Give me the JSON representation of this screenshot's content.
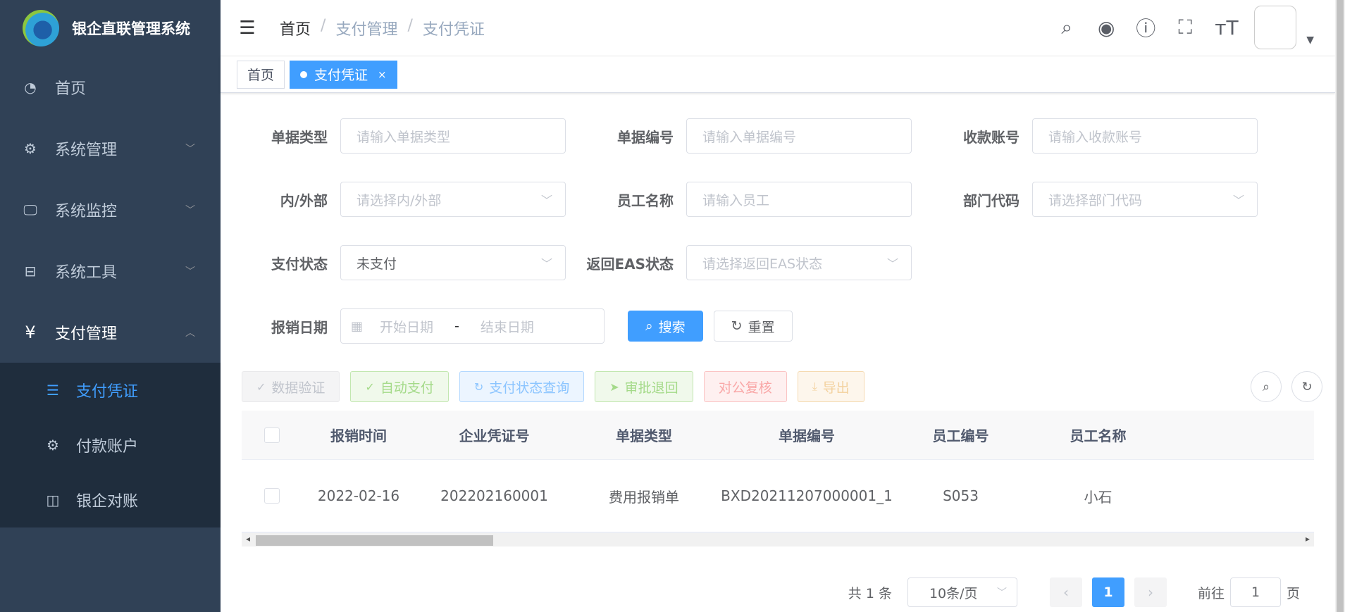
{
  "app": {
    "title": "银企直联管理系统"
  },
  "sidebar": {
    "items": [
      {
        "label": "首页",
        "icon": "dashboard-icon"
      },
      {
        "label": "系统管理",
        "icon": "gear-icon"
      },
      {
        "label": "系统监控",
        "icon": "monitor-icon"
      },
      {
        "label": "系统工具",
        "icon": "toolbox-icon"
      },
      {
        "label": "支付管理",
        "icon": "yen-icon"
      }
    ],
    "submenu": [
      {
        "label": "支付凭证",
        "icon": "list-icon"
      },
      {
        "label": "付款账户",
        "icon": "gear-icon"
      },
      {
        "label": "银企对账",
        "icon": "columns-icon"
      }
    ]
  },
  "breadcrumb": {
    "home": "首页",
    "level1": "支付管理",
    "level2": "支付凭证",
    "sep": "/"
  },
  "tags": {
    "home": "首页",
    "active": "支付凭证",
    "close": "×"
  },
  "form": {
    "doc_type": {
      "label": "单据类型",
      "placeholder": "请输入单据类型"
    },
    "doc_no": {
      "label": "单据编号",
      "placeholder": "请输入单据编号"
    },
    "recv_account": {
      "label": "收款账号",
      "placeholder": "请输入收款账号"
    },
    "inner_outer": {
      "label": "内/外部",
      "placeholder": "请选择内/外部"
    },
    "employee": {
      "label": "员工名称",
      "placeholder": "请输入员工"
    },
    "dept_code": {
      "label": "部门代码",
      "placeholder": "请选择部门代码"
    },
    "pay_status": {
      "label": "支付状态",
      "value": "未支付"
    },
    "eas_status": {
      "label": "返回EAS状态",
      "placeholder": "请选择返回EAS状态"
    },
    "date": {
      "label": "报销日期",
      "start": "开始日期",
      "sep": "-",
      "end": "结束日期"
    },
    "search_btn": "搜索",
    "reset_btn": "重置"
  },
  "toolbar": {
    "verify": "数据验证",
    "auto_pay": "自动支付",
    "status_query": "支付状态查询",
    "reject": "审批退回",
    "recheck": "对公复核",
    "export": "导出"
  },
  "table": {
    "headers": [
      "报销时间",
      "企业凭证号",
      "单据类型",
      "单据编号",
      "员工编号",
      "员工名称"
    ],
    "rows": [
      [
        "2022-02-16",
        "202202160001",
        "费用报销单",
        "BXD20211207000001_1",
        "S053",
        "小石"
      ]
    ]
  },
  "pager": {
    "total": "共 1 条",
    "page_size": "10条/页",
    "current": "1",
    "goto_label": "前往",
    "goto_value": "1",
    "page_unit": "页"
  },
  "colors": {
    "sidebar_bg": "#304156",
    "submenu_bg": "#1f2d3d",
    "primary": "#409eff"
  }
}
